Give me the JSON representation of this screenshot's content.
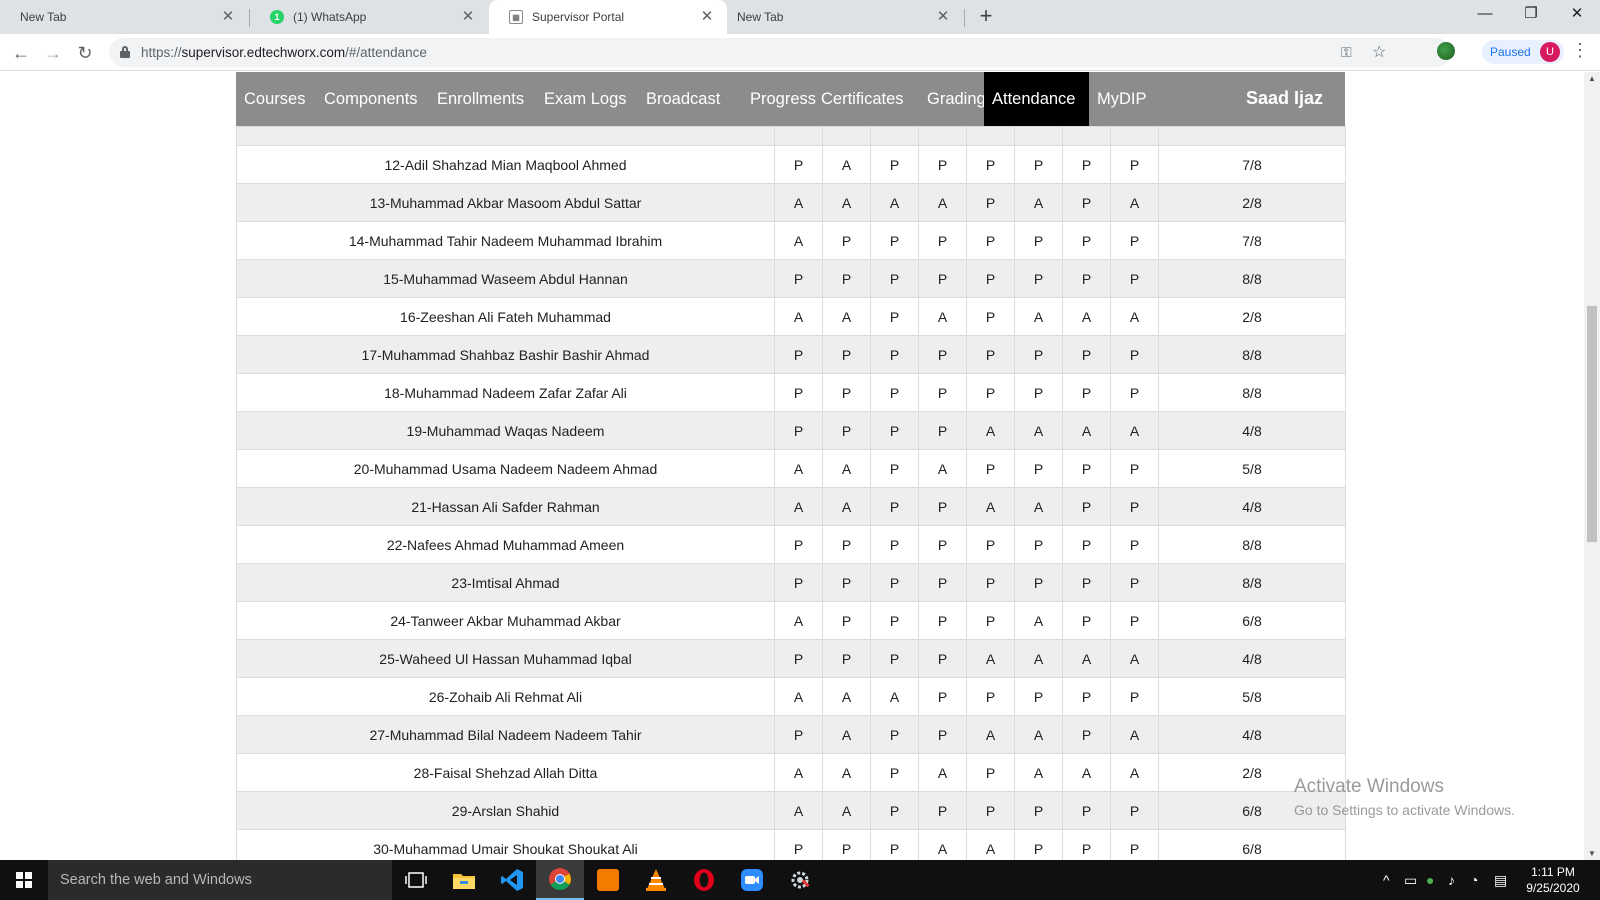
{
  "browser": {
    "tabs": [
      {
        "title": "New Tab",
        "close": "✕"
      },
      {
        "title": "(1) WhatsApp",
        "badge": "1",
        "close": "✕"
      },
      {
        "title": "Supervisor Portal",
        "close": "✕"
      },
      {
        "title": "New Tab",
        "close": "✕"
      }
    ],
    "new_tab_glyph": "+",
    "window_controls": {
      "minimize": "—",
      "restore": "❐",
      "close": "✕"
    },
    "nav": {
      "back": "←",
      "forward": "→",
      "reload": "↻"
    },
    "url": {
      "scheme": "https://",
      "host": "supervisor.edtechworx.com",
      "path": "/#/attendance"
    },
    "omnibox_icons": {
      "key": "⚿",
      "star": "☆"
    },
    "profile": {
      "status": "Paused",
      "avatar_letter": "U"
    },
    "menu_glyph": "⋮"
  },
  "nav": {
    "items": [
      "Courses",
      "Components",
      "Enrollments",
      "Exam Logs",
      "Broadcast",
      "Progress",
      "Certificates",
      "Grading",
      "Attendance",
      "MyDIP"
    ],
    "active": "Attendance",
    "user": "Saad Ijaz"
  },
  "attendance": {
    "rows": [
      {
        "name": "12-Adil Shahzad Mian Maqbool Ahmed",
        "marks": [
          "P",
          "A",
          "P",
          "P",
          "P",
          "P",
          "P",
          "P"
        ],
        "total": "7/8"
      },
      {
        "name": "13-Muhammad Akbar Masoom Abdul Sattar",
        "marks": [
          "A",
          "A",
          "A",
          "A",
          "P",
          "A",
          "P",
          "A"
        ],
        "total": "2/8"
      },
      {
        "name": "14-Muhammad Tahir Nadeem Muhammad Ibrahim",
        "marks": [
          "A",
          "P",
          "P",
          "P",
          "P",
          "P",
          "P",
          "P"
        ],
        "total": "7/8"
      },
      {
        "name": "15-Muhammad Waseem Abdul Hannan",
        "marks": [
          "P",
          "P",
          "P",
          "P",
          "P",
          "P",
          "P",
          "P"
        ],
        "total": "8/8"
      },
      {
        "name": "16-Zeeshan Ali Fateh Muhammad",
        "marks": [
          "A",
          "A",
          "P",
          "A",
          "P",
          "A",
          "A",
          "A"
        ],
        "total": "2/8"
      },
      {
        "name": "17-Muhammad Shahbaz Bashir Bashir Ahmad",
        "marks": [
          "P",
          "P",
          "P",
          "P",
          "P",
          "P",
          "P",
          "P"
        ],
        "total": "8/8"
      },
      {
        "name": "18-Muhammad Nadeem Zafar Zafar Ali",
        "marks": [
          "P",
          "P",
          "P",
          "P",
          "P",
          "P",
          "P",
          "P"
        ],
        "total": "8/8"
      },
      {
        "name": "19-Muhammad Waqas Nadeem",
        "marks": [
          "P",
          "P",
          "P",
          "P",
          "A",
          "A",
          "A",
          "A"
        ],
        "total": "4/8"
      },
      {
        "name": "20-Muhammad Usama Nadeem Nadeem Ahmad",
        "marks": [
          "A",
          "A",
          "P",
          "A",
          "P",
          "P",
          "P",
          "P"
        ],
        "total": "5/8"
      },
      {
        "name": "21-Hassan Ali Safder Rahman",
        "marks": [
          "A",
          "A",
          "P",
          "P",
          "A",
          "A",
          "P",
          "P"
        ],
        "total": "4/8"
      },
      {
        "name": "22-Nafees Ahmad Muhammad Ameen",
        "marks": [
          "P",
          "P",
          "P",
          "P",
          "P",
          "P",
          "P",
          "P"
        ],
        "total": "8/8"
      },
      {
        "name": "23-Imtisal Ahmad",
        "marks": [
          "P",
          "P",
          "P",
          "P",
          "P",
          "P",
          "P",
          "P"
        ],
        "total": "8/8"
      },
      {
        "name": "24-Tanweer Akbar Muhammad Akbar",
        "marks": [
          "A",
          "P",
          "P",
          "P",
          "P",
          "A",
          "P",
          "P"
        ],
        "total": "6/8"
      },
      {
        "name": "25-Waheed Ul Hassan Muhammad Iqbal",
        "marks": [
          "P",
          "P",
          "P",
          "P",
          "A",
          "A",
          "A",
          "A"
        ],
        "total": "4/8"
      },
      {
        "name": "26-Zohaib Ali Rehmat Ali",
        "marks": [
          "A",
          "A",
          "A",
          "P",
          "P",
          "P",
          "P",
          "P"
        ],
        "total": "5/8"
      },
      {
        "name": "27-Muhammad Bilal Nadeem Nadeem Tahir",
        "marks": [
          "P",
          "A",
          "P",
          "P",
          "A",
          "A",
          "P",
          "A"
        ],
        "total": "4/8"
      },
      {
        "name": "28-Faisal Shehzad Allah Ditta",
        "marks": [
          "A",
          "A",
          "P",
          "A",
          "P",
          "A",
          "A",
          "A"
        ],
        "total": "2/8"
      },
      {
        "name": "29-Arslan Shahid",
        "marks": [
          "A",
          "A",
          "P",
          "P",
          "P",
          "P",
          "P",
          "P"
        ],
        "total": "6/8"
      },
      {
        "name": "30-Muhammad Umair Shoukat Shoukat Ali",
        "marks": [
          "P",
          "P",
          "P",
          "A",
          "A",
          "P",
          "P",
          "P"
        ],
        "total": "6/8"
      }
    ]
  },
  "watermark": {
    "line1": "Activate Windows",
    "line2": "Go to Settings to activate Windows."
  },
  "taskbar": {
    "search_placeholder": "Search the web and Windows",
    "apps": [
      "task-view",
      "file-explorer",
      "vscode",
      "chrome",
      "app-orange",
      "vlc",
      "opera",
      "zoom",
      "app-gear"
    ],
    "active_app": "chrome",
    "clock": {
      "time": "1:11 PM",
      "date": "9/25/2020"
    }
  },
  "colors": {
    "navbar_bg": "#8c8c8c",
    "nav_active_bg": "#000000",
    "row_alt_bg": "#eeeeee",
    "taskbar_bg": "#101010"
  }
}
